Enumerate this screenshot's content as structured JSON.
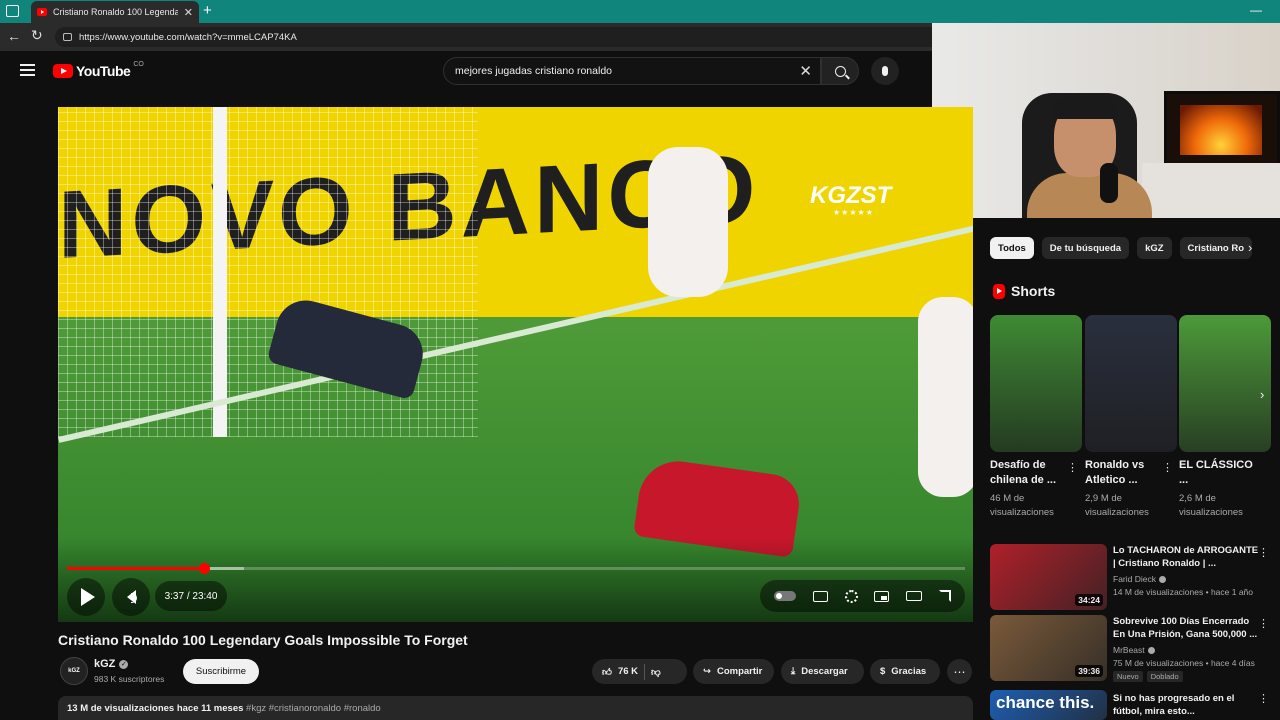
{
  "browser": {
    "tab_title": "Cristiano Ronaldo 100 Legendary Goals Impossible To Forget",
    "new_tab": "+",
    "url": "https://www.youtube.com/watch?v=mmeLCAP74KA"
  },
  "header": {
    "logo_text": "YouTube",
    "country_code": "CO",
    "search_query": "mejores jugadas cristiano ronaldo"
  },
  "player": {
    "banner_text": "NOVO BANCO",
    "watermark": "KGZST",
    "watermark_stars": "★★★★★",
    "time": "3:37 / 23:40",
    "progress": 0.153
  },
  "video": {
    "title": "Cristiano Ronaldo 100 Legendary Goals Impossible To Forget",
    "channel": "kGZ",
    "channel_avatar_text": "kGZ",
    "subscribers": "983 K suscriptores",
    "subscribe_label": "Suscribirme",
    "likes": "76 K",
    "share_label": "Compartir",
    "download_label": "Descargar",
    "thanks_label": "Gracias",
    "views_date": "13 M de visualizaciones  hace 11 meses",
    "tags": "#kgz #cristianoronaldo #ronaldo"
  },
  "sidebar": {
    "chips": [
      "Todos",
      "De tu búsqueda",
      "kGZ",
      "Cristiano Ro"
    ],
    "shorts_heading": "Shorts",
    "shorts": [
      {
        "title": "Desafío de chilena de ...",
        "views": "46 M de visualizaciones",
        "thumb_color": "#3f8a34"
      },
      {
        "title": "Ronaldo vs Atletico ...",
        "views": "2,9 M de visualizaciones",
        "thumb_color": "#2a2f3d"
      },
      {
        "title": "EL CLÁSSICO ...",
        "views": "2,6 M de visualizaciones",
        "thumb_color": "#4c9a3a"
      }
    ],
    "recommended": [
      {
        "title": "Lo TACHARON de ARROGANTE | Cristiano Ronaldo | ...",
        "channel": "Farid Dieck",
        "meta": "14 M de visualizaciones • hace 1 año",
        "duration": "34:24",
        "thumb_color": "#b0202a"
      },
      {
        "title": "Sobrevive 100 Días Encerrado En Una Prisión, Gana 500,000 ...",
        "channel": "MrBeast",
        "meta": "75 M de visualizaciones • hace 4 días",
        "duration": "39:36",
        "badges": [
          "Nuevo",
          "Doblado"
        ],
        "thumb_color": "#7a5a3a"
      },
      {
        "title": "Si no has progresado en el fútbol, mira esto...",
        "thumb_text": "chance this.",
        "thumb_color": "#1e5fb3"
      }
    ]
  },
  "colors": {
    "accent": "#ff0000",
    "tabbar": "#10857c",
    "background": "#0f0f0f"
  }
}
